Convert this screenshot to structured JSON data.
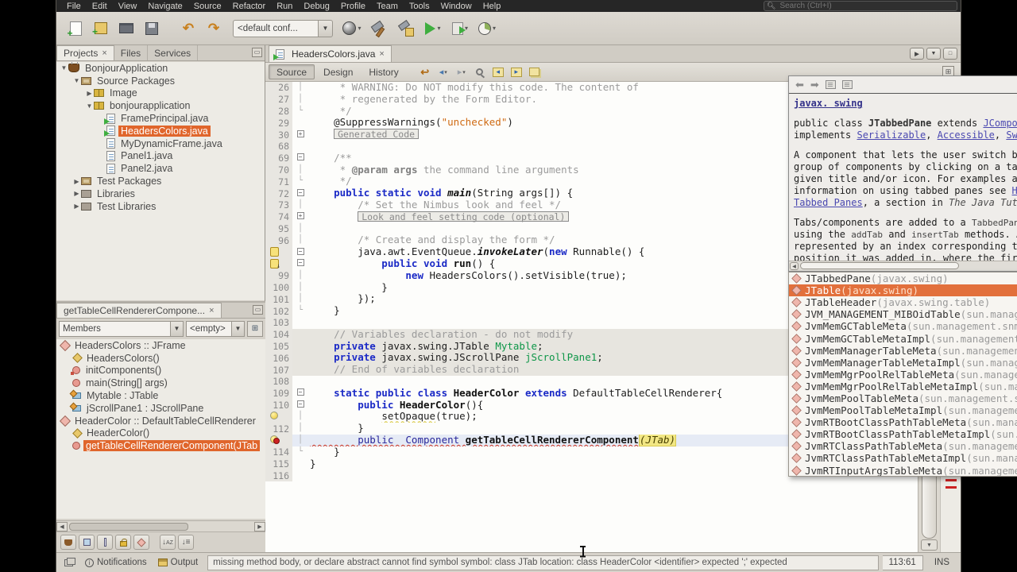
{
  "colors": {
    "selection_orange": "#e2703c",
    "menubar_bg": "#262626",
    "toolbar_bg": "#d6d2ca",
    "editor_bg": "#fdfdfb",
    "error_red": "#cc2222",
    "warning_yellow": "#d9c42e",
    "keyword_blue": "#1b2ac6",
    "field_green": "#0e9648",
    "string_orange": "#cf6a12"
  },
  "menubar": {
    "items": [
      "File",
      "Edit",
      "View",
      "Navigate",
      "Source",
      "Refactor",
      "Run",
      "Debug",
      "Profile",
      "Team",
      "Tools",
      "Window",
      "Help"
    ],
    "search_placeholder": "Search (Ctrl+I)"
  },
  "toolbar": {
    "config_value": "<default conf...",
    "group1": [
      {
        "name": "new-file-button",
        "icon": "newfile"
      },
      {
        "name": "new-project-button",
        "icon": "newproj"
      },
      {
        "name": "open-project-button",
        "icon": "openproj"
      },
      {
        "name": "save-all-button",
        "icon": "saveall"
      }
    ],
    "group2": [
      {
        "name": "undo-button",
        "icon": "undo",
        "glyph": "↶"
      },
      {
        "name": "redo-button",
        "icon": "redo",
        "glyph": "↷"
      }
    ],
    "group3": [
      {
        "name": "build-artifact-button",
        "icon": "ball",
        "dd": true
      },
      {
        "name": "build-project-button",
        "icon": "hammer"
      },
      {
        "name": "clean-build-project-button",
        "icon": "hammerclean"
      },
      {
        "name": "run-project-button",
        "icon": "run",
        "dd": true
      },
      {
        "name": "debug-project-button",
        "icon": "debug",
        "dd": true
      },
      {
        "name": "profile-project-button",
        "icon": "profile",
        "dd": true
      }
    ]
  },
  "projects_panel": {
    "tabs": [
      {
        "label": "Projects",
        "closable": true,
        "active": true
      },
      {
        "label": "Files",
        "closable": false,
        "active": false
      },
      {
        "label": "Services",
        "closable": false,
        "active": false
      }
    ],
    "tree": [
      {
        "d": 0,
        "exp": "open",
        "icon": "project",
        "label": "BonjourApplication"
      },
      {
        "d": 1,
        "exp": "open",
        "icon": "pkgroot",
        "label": "Source Packages"
      },
      {
        "d": 2,
        "exp": "closed",
        "icon": "pkg",
        "label": "Image"
      },
      {
        "d": 2,
        "exp": "open",
        "icon": "pkg",
        "label": "bonjourapplication"
      },
      {
        "d": 3,
        "exp": "none",
        "icon": "java-main",
        "label": "FramePrincipal.java"
      },
      {
        "d": 3,
        "exp": "none",
        "icon": "java-main",
        "label": "HeadersColors.java",
        "selected": true
      },
      {
        "d": 3,
        "exp": "none",
        "icon": "java",
        "label": "MyDynamicFrame.java"
      },
      {
        "d": 3,
        "exp": "none",
        "icon": "java",
        "label": "Panel1.java"
      },
      {
        "d": 3,
        "exp": "none",
        "icon": "java",
        "label": "Panel2.java"
      },
      {
        "d": 1,
        "exp": "closed",
        "icon": "pkgroot",
        "label": "Test Packages"
      },
      {
        "d": 1,
        "exp": "closed",
        "icon": "lib",
        "label": "Libraries"
      },
      {
        "d": 1,
        "exp": "closed",
        "icon": "lib",
        "label": "Test Libraries"
      }
    ]
  },
  "navigator_panel": {
    "title": "getTableCellRendererCompone...",
    "filters": {
      "left": "Members",
      "right": "<empty>"
    },
    "tree": [
      {
        "d": 0,
        "icon": "class",
        "label": "HeadersColors :: JFrame"
      },
      {
        "d": 1,
        "icon": "constructor",
        "label": "HeadersColors()"
      },
      {
        "d": 1,
        "icon": "method-private",
        "label": "initComponents()"
      },
      {
        "d": 1,
        "icon": "method-static",
        "label": "main(String[] args)"
      },
      {
        "d": 1,
        "icon": "field",
        "label": "Mytable : JTable"
      },
      {
        "d": 1,
        "icon": "field",
        "label": "jScrollPane1 : JScrollPane"
      },
      {
        "d": 0,
        "icon": "class-inner",
        "label": "HeaderColor :: DefaultTableCellRenderer"
      },
      {
        "d": 1,
        "icon": "constructor",
        "label": "HeaderColor()"
      },
      {
        "d": 1,
        "icon": "method-public",
        "label": "getTableCellRendererComponent(JTab",
        "selected": true
      }
    ]
  },
  "editor": {
    "tab": {
      "label": "HeadersColors.java"
    },
    "views": [
      {
        "label": "Source",
        "active": true
      },
      {
        "label": "Design",
        "active": false
      },
      {
        "label": "History",
        "active": false
      }
    ],
    "toolbar_icons": [
      {
        "name": "last-edit-button",
        "icon": "lastedit",
        "glyph": "↩"
      },
      {
        "name": "back-button",
        "icon": "back",
        "glyph": "◂",
        "dd": true
      },
      {
        "name": "forward-button",
        "icon": "fwd",
        "glyph": "▸",
        "dd": true
      },
      {
        "name": "find-selection-button",
        "icon": "find"
      },
      {
        "name": "previous-occurrence-button",
        "icon": "chip",
        "glyph": "◂"
      },
      {
        "name": "next-occurrence-button",
        "icon": "chip",
        "glyph": "▸"
      },
      {
        "name": "toggle-highlight-button",
        "icon": "hl"
      }
    ],
    "lines": [
      {
        "n": "26",
        "fold": "line",
        "seg": [
          [
            "cmt",
            "     * WARNING: Do NOT modify this code. The content of"
          ]
        ]
      },
      {
        "n": "27",
        "fold": "line",
        "seg": [
          [
            "cmt",
            "     * regenerated by the Form Editor."
          ]
        ]
      },
      {
        "n": "28",
        "fold": "end",
        "seg": [
          [
            "cmt",
            "     */"
          ]
        ]
      },
      {
        "n": "29",
        "fold": "",
        "seg": [
          [
            "pln",
            "    @SuppressWarnings("
          ],
          [
            "str",
            "\"unchecked\""
          ],
          [
            "pln",
            ")"
          ]
        ]
      },
      {
        "n": "30",
        "fold": "closed",
        "ind": 4,
        "box": "Generated Code"
      },
      {
        "n": "68",
        "fold": "",
        "seg": []
      },
      {
        "n": "69",
        "fold": "open",
        "seg": [
          [
            "cmt",
            "    /**"
          ]
        ]
      },
      {
        "n": "70",
        "fold": "line",
        "seg": [
          [
            "cmt",
            "     * "
          ],
          [
            "cmtb",
            "@param args"
          ],
          [
            "cmt",
            " the command line arguments"
          ]
        ]
      },
      {
        "n": "71",
        "fold": "end",
        "seg": [
          [
            "cmt",
            "     */"
          ]
        ]
      },
      {
        "n": "72",
        "fold": "open",
        "seg": [
          [
            "kw",
            "    public static void "
          ],
          [
            "mtdi",
            "main"
          ],
          [
            "pln",
            "(String args[]) {"
          ]
        ]
      },
      {
        "n": "73",
        "fold": "line",
        "seg": [
          [
            "cmt",
            "        /* Set the Nimbus look and feel */"
          ]
        ]
      },
      {
        "n": "74",
        "fold": "closed",
        "ind": 8,
        "box": "Look and feel setting code (optional)"
      },
      {
        "n": "95",
        "fold": "line",
        "seg": []
      },
      {
        "n": "96",
        "fold": "line",
        "seg": [
          [
            "cmt",
            "        /* Create and display the form */"
          ]
        ]
      },
      {
        "n": "97",
        "ann": "warn",
        "fold": "open",
        "seg": [
          [
            "pln",
            "        java.awt.EventQueue."
          ],
          [
            "itlb",
            "invokeLater"
          ],
          [
            "pln",
            "("
          ],
          [
            "kw",
            "new"
          ],
          [
            "pln",
            " Runnable() {"
          ]
        ]
      },
      {
        "n": "98",
        "ann": "warn-down",
        "fold": "open",
        "seg": [
          [
            "kw",
            "            public void "
          ],
          [
            "mtd",
            "run"
          ],
          [
            "pln",
            "() {"
          ]
        ]
      },
      {
        "n": "99",
        "fold": "line",
        "seg": [
          [
            "kw",
            "                new"
          ],
          [
            "pln",
            " HeadersColors().setVisible(true);"
          ]
        ]
      },
      {
        "n": "100",
        "fold": "mid",
        "seg": [
          [
            "pln",
            "            }"
          ]
        ]
      },
      {
        "n": "101",
        "fold": "mid",
        "seg": [
          [
            "pln",
            "        });"
          ]
        ]
      },
      {
        "n": "102",
        "fold": "end",
        "seg": [
          [
            "pln",
            "    }"
          ]
        ]
      },
      {
        "n": "103",
        "fold": "",
        "seg": []
      },
      {
        "n": "104",
        "bg": "gen",
        "fold": "",
        "seg": [
          [
            "cmt",
            "    // Variables declaration - do not modify"
          ]
        ]
      },
      {
        "n": "105",
        "bg": "gen",
        "fold": "",
        "seg": [
          [
            "kw",
            "    private"
          ],
          [
            "pln",
            " javax.swing.JTable "
          ],
          [
            "fld",
            "Mytable"
          ],
          [
            "pln",
            ";"
          ]
        ]
      },
      {
        "n": "106",
        "bg": "gen",
        "fold": "",
        "seg": [
          [
            "kw",
            "    private"
          ],
          [
            "pln",
            " javax.swing.JScrollPane "
          ],
          [
            "fld",
            "jScrollPane1"
          ],
          [
            "pln",
            ";"
          ]
        ]
      },
      {
        "n": "107",
        "bg": "gen",
        "fold": "",
        "seg": [
          [
            "cmt",
            "    // End of variables declaration"
          ]
        ]
      },
      {
        "n": "108",
        "fold": "",
        "seg": []
      },
      {
        "n": "109",
        "fold": "open",
        "seg": [
          [
            "kw",
            "    static public class "
          ],
          [
            "clsb",
            "HeaderColor"
          ],
          [
            "kw",
            " extends "
          ],
          [
            "pln",
            "DefaultTableCellRenderer{"
          ]
        ]
      },
      {
        "n": "110",
        "fold": "open",
        "seg": [
          [
            "kw",
            "        public "
          ],
          [
            "clsb",
            "HeaderColor"
          ],
          [
            "pln",
            "(){"
          ]
        ]
      },
      {
        "n": "111",
        "ann": "bulb",
        "fold": "line",
        "seg": [
          [
            "pln",
            "            "
          ],
          [
            "ulw",
            "setOpaque"
          ],
          [
            "pln",
            "(true);"
          ]
        ]
      },
      {
        "n": "112",
        "fold": "mid",
        "seg": [
          [
            "pln",
            "        }"
          ]
        ]
      },
      {
        "n": "113",
        "ann": "bulb-err",
        "fold": "line",
        "bg": "cur",
        "seg": [
          [
            "ulr",
            "        public  Component "
          ],
          [
            "ulrb",
            "getTableCellRendererComponent"
          ],
          [
            "hli",
            "(JTab)"
          ]
        ]
      },
      {
        "n": "114",
        "fold": "end",
        "seg": [
          [
            "pln",
            "    }"
          ]
        ]
      },
      {
        "n": "115",
        "fold": "",
        "seg": [
          [
            "pln",
            "}"
          ]
        ]
      },
      {
        "n": "116",
        "fold": "",
        "seg": []
      }
    ]
  },
  "javadoc_popup": {
    "paragraphs": [
      [
        [
          "lnkb",
          "javax. swing"
        ]
      ],
      [
        [
          "pln",
          "public class "
        ],
        [
          "b",
          "JTabbedPane"
        ],
        [
          "pln",
          " extends "
        ],
        [
          "lnk",
          "JComponent"
        ],
        [
          "pln",
          " implements "
        ],
        [
          "lnk",
          "Serializable"
        ],
        [
          "pln",
          ", "
        ],
        [
          "lnk",
          "Accessible"
        ],
        [
          "pln",
          ", "
        ],
        [
          "lnk",
          "SwingConstants"
        ]
      ],
      [
        [
          "pln",
          "A component that lets the user switch between a group of components by clicking on a tab with a given title and/or icon. For examples and information on using tabbed panes see "
        ],
        [
          "lnk",
          "How to Use Tabbed Panes"
        ],
        [
          "pln",
          ", a section in "
        ],
        [
          "i",
          "The Java Tutorial"
        ],
        [
          "pln",
          "."
        ]
      ],
      [
        [
          "pln",
          "Tabs/components are added to a "
        ],
        [
          "codespan",
          "TabbedPane"
        ],
        [
          "pln",
          " object by using the "
        ],
        [
          "codespan",
          "addTab"
        ],
        [
          "pln",
          " and "
        ],
        [
          "codespan",
          "insertTab"
        ],
        [
          "pln",
          " methods. A tab is represented by an index corresponding to the position it was added in, where the first tab has an"
        ]
      ]
    ]
  },
  "completion_popup": {
    "items": [
      {
        "name": "JTabbedPane",
        "pkg": "javax.swing"
      },
      {
        "name": "JTable",
        "pkg": "javax.swing",
        "selected": true
      },
      {
        "name": "JTableHeader",
        "pkg": "javax.swing.table"
      },
      {
        "name": "JVM_MANAGEMENT_MIBOidTable",
        "pkg": "sun.management.snmp.jvmmib"
      },
      {
        "name": "JvmMemGCTableMeta",
        "pkg": "sun.management.snmp.jvmmib"
      },
      {
        "name": "JvmMemGCTableMetaImpl",
        "pkg": "sun.management.snmp.jvminstr"
      },
      {
        "name": "JvmMemManagerTableMeta",
        "pkg": "sun.management.snmp.jvmmib"
      },
      {
        "name": "JvmMemManagerTableMetaImpl",
        "pkg": "sun.management.snmp.jvminstr"
      },
      {
        "name": "JvmMemMgrPoolRelTableMeta",
        "pkg": "sun.management.snmp.jvmmib"
      },
      {
        "name": "JvmMemMgrPoolRelTableMetaImpl",
        "pkg": "sun.management.snmp.jvminstr"
      },
      {
        "name": "JvmMemPoolTableMeta",
        "pkg": "sun.management.snmp.jvmmib"
      },
      {
        "name": "JvmMemPoolTableMetaImpl",
        "pkg": "sun.management.snmp.jvminstr"
      },
      {
        "name": "JvmRTBootClassPathTableMeta",
        "pkg": "sun.management.snmp.jvmmib"
      },
      {
        "name": "JvmRTBootClassPathTableMetaImpl",
        "pkg": "sun.management.snmp.jvmin…"
      },
      {
        "name": "JvmRTClassPathTableMeta",
        "pkg": "sun.management.snmp.jvmmib"
      },
      {
        "name": "JvmRTClassPathTableMetaImpl",
        "pkg": "sun.management.snmp.jvminstr"
      },
      {
        "name": "JvmRTInputArgsTableMeta",
        "pkg": "sun.management.snmp.jvmmib"
      }
    ]
  },
  "status_bar": {
    "tabs": [
      {
        "label": "Notifications",
        "icon": "info"
      },
      {
        "label": "Output",
        "icon": "output"
      }
    ],
    "message": "missing method body, or declare abstract  cannot find symbol  symbol:  class JTab  location: class HeaderColor  <identifier> expected  ';' expected",
    "caret": "113:61",
    "mode": "INS"
  }
}
